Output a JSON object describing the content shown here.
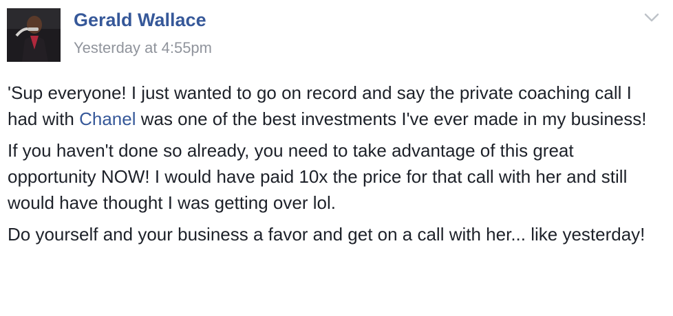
{
  "author": {
    "name": "Gerald Wallace",
    "avatar_icon": "profile-photo",
    "timestamp": "Yesterday at 4:55pm"
  },
  "menu": {
    "icon": "chevron-down-icon"
  },
  "post": {
    "p1_before": "'Sup everyone! I just wanted to go on record and say the private coaching call I had with ",
    "p1_mention": "Chanel",
    "p1_after": " was one of the best investments I've ever made in my business!",
    "p2": "If you haven't done so already, you need to take advantage of this great opportunity NOW! I would have paid 10x the price for that call with her and still would have thought I was getting over lol.",
    "p3": "Do yourself and your business a favor and get on a call with her... like yesterday!"
  },
  "colors": {
    "link": "#365899",
    "text": "#1d2129",
    "meta": "#90949c"
  }
}
